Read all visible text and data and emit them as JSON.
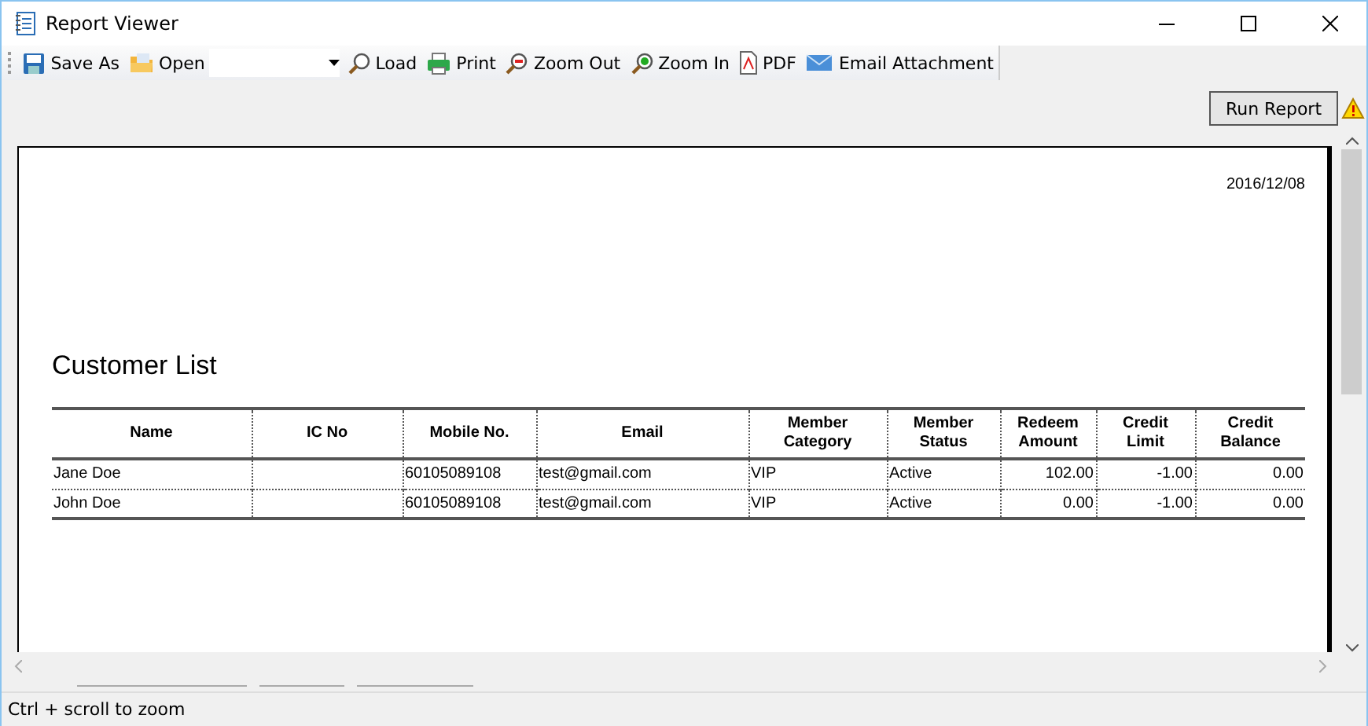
{
  "window": {
    "title": "Report Viewer"
  },
  "toolbar": {
    "items": [
      {
        "kind": "button",
        "label": "Save As"
      },
      {
        "kind": "button",
        "label": "Open"
      },
      {
        "kind": "combo"
      },
      {
        "kind": "button",
        "label": "Load"
      },
      {
        "kind": "button",
        "label": "Print"
      },
      {
        "kind": "button",
        "label": "Zoom Out"
      },
      {
        "kind": "button",
        "label": "Zoom In"
      },
      {
        "kind": "button",
        "label": "PDF"
      },
      {
        "kind": "button",
        "label": "Email Attachment"
      }
    ]
  },
  "run_button": "Run Report",
  "report": {
    "date": "2016/12/08",
    "title": "Customer List",
    "columns": [
      {
        "label": "Name",
        "kind": "text"
      },
      {
        "label": "IC No",
        "kind": "text"
      },
      {
        "label": "Mobile No.",
        "kind": "text"
      },
      {
        "label": "Email",
        "kind": "text"
      },
      {
        "label": "Member Category",
        "kind": "text"
      },
      {
        "label": "Member Status",
        "kind": "text"
      },
      {
        "label": "Redeem Amount",
        "kind": "number"
      },
      {
        "label": "Credit Limit",
        "kind": "number"
      },
      {
        "label": "Credit Balance",
        "kind": "number"
      }
    ],
    "rows": [
      [
        "Jane Doe",
        "",
        "60105089108",
        "test@gmail.com",
        "VIP",
        "Active",
        "102.00",
        "-1.00",
        "0.00"
      ],
      [
        "John Doe",
        "",
        "60105089108",
        "test@gmail.com",
        "VIP",
        "Active",
        "0.00",
        "-1.00",
        "0.00"
      ]
    ]
  },
  "status_bar": "Ctrl + scroll to zoom"
}
